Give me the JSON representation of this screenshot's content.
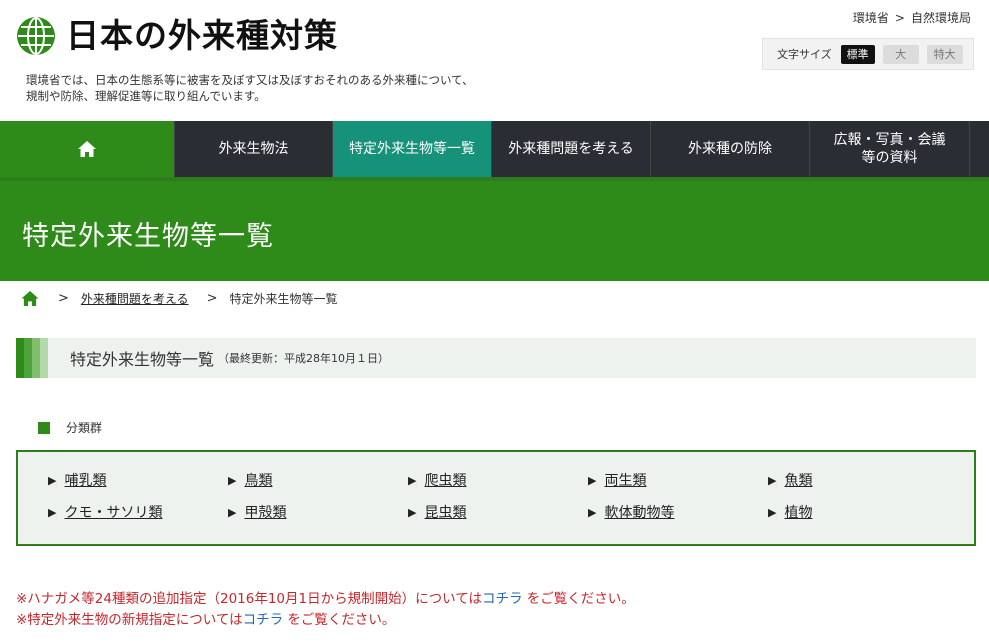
{
  "header": {
    "site_title": "日本の外来種対策",
    "tagline_line1": "環境省では、日本の生態系等に被害を及ぼす又は及ぼすおそれのある外来種について、",
    "tagline_line2": "規制や防除、理解促進等に取り組んでいます。",
    "top_breadcrumb": [
      "環境省",
      "自然環境局"
    ],
    "top_breadcrumb_sep": ">",
    "font_size": {
      "label": "文字サイズ",
      "options": [
        "標準",
        "大",
        "特大"
      ],
      "selected": "標準"
    },
    "globe_icon": "globe-icon"
  },
  "nav": {
    "home_icon": "home-icon",
    "items": [
      "外来生物法",
      "特定外来生物等一覧",
      "外来種問題を考える",
      "外来種の防除",
      "広報・写真・会議\n等の資料"
    ],
    "active": "特定外来生物等一覧"
  },
  "hero": {
    "title": "特定外来生物等一覧"
  },
  "breadcrumb": {
    "home_icon": "home-icon",
    "sep": ">",
    "items": [
      "外来種問題を考える",
      "特定外来生物等一覧"
    ]
  },
  "section": {
    "title": "特定外来生物等一覧",
    "note": "（最終更新：平成28年10月１日）"
  },
  "categories": {
    "label": "分類群",
    "row1": [
      "哺乳類",
      "鳥類",
      "爬虫類",
      "両生類",
      "魚類"
    ],
    "row2": [
      "クモ・サソリ類",
      "甲殻類",
      "昆虫類",
      "軟体動物等",
      "植物"
    ]
  },
  "notes": {
    "note1_prefix": "※ハナガメ等24種類の追加指定（2016年10月1日から規制開始）については",
    "note1_link": "コチラ",
    "note1_suffix": " をご覧ください。",
    "note2_prefix": "※特定外来生物の新規指定については",
    "note2_link": "コチラ",
    "note2_suffix": " をご覧ください。"
  },
  "colors": {
    "green": "#2e8b1a",
    "nav_dark": "#2a2d34",
    "nav_active": "#16917a",
    "note_red": "#c8262b",
    "link_blue": "#1f66b5"
  }
}
